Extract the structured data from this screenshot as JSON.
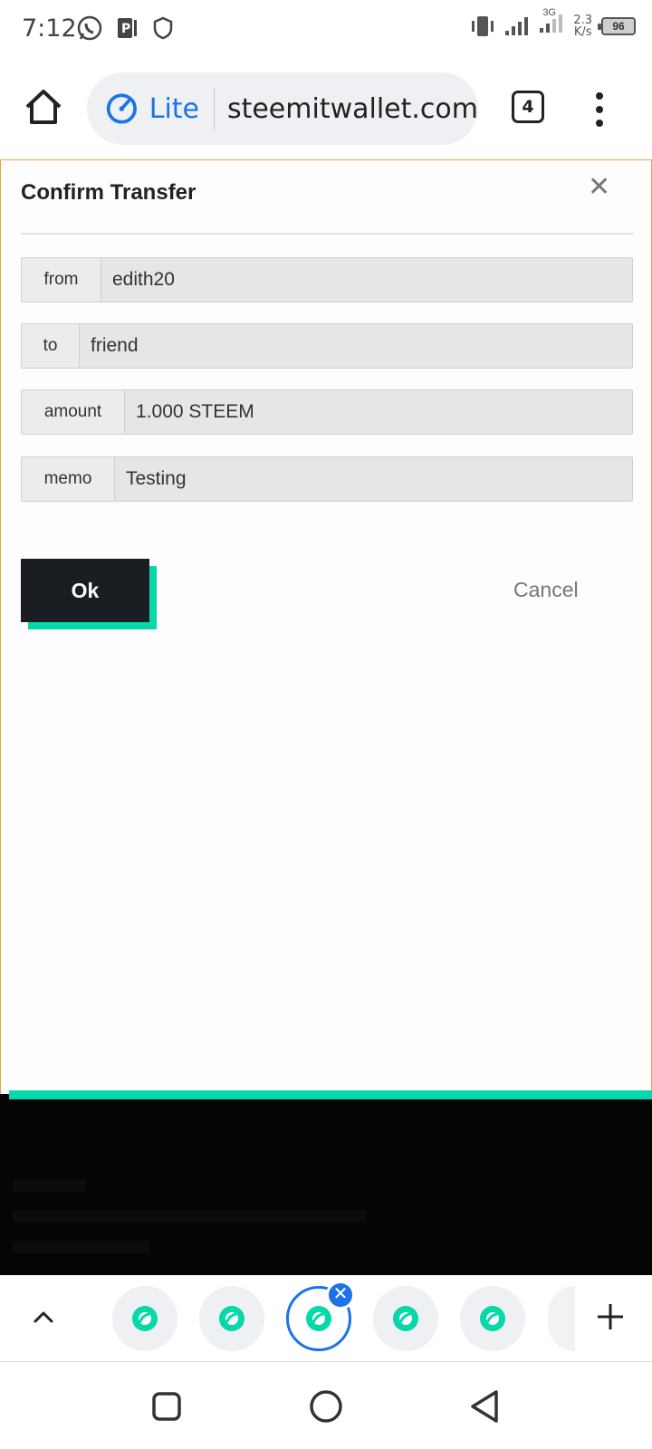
{
  "status_bar": {
    "time": "7:12",
    "network": "3G",
    "speed_value": "2.3",
    "speed_unit": "K/s",
    "battery": "96",
    "icons": [
      "whatsapp-icon",
      "parking-icon",
      "shield-icon",
      "vibrate-icon",
      "signal-icon",
      "signal-3g-icon",
      "battery-icon"
    ]
  },
  "browser": {
    "mode_label": "Lite",
    "url": "steemitwallet.com",
    "tab_count": "4",
    "accent_color": "#1a73e8"
  },
  "dialog": {
    "title": "Confirm Transfer",
    "fields": [
      {
        "label": "from",
        "value": "edith20"
      },
      {
        "label": "to",
        "value": "friend"
      },
      {
        "label": "amount",
        "value": "1.000 STEEM"
      },
      {
        "label": "memo",
        "value": "Testing"
      }
    ],
    "ok_label": "Ok",
    "cancel_label": "Cancel",
    "accent_color": "#07d7a9"
  },
  "tab_switcher": {
    "tabs": [
      "steemit-tab-1",
      "steemit-tab-2",
      "steemit-tab-3-active",
      "steemit-tab-4",
      "steemit-tab-5"
    ],
    "active_index": 2
  }
}
